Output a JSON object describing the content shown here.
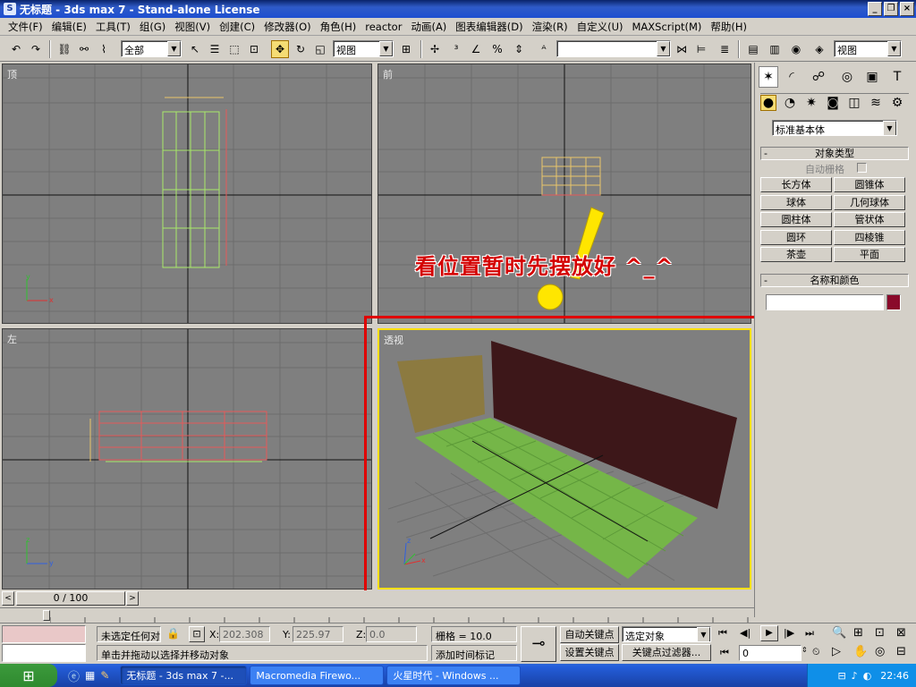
{
  "window": {
    "title": "无标题 - 3ds max 7 - Stand-alone License",
    "icon": "3dsmax-icon"
  },
  "menu": [
    "文件(F)",
    "编辑(E)",
    "工具(T)",
    "组(G)",
    "视图(V)",
    "创建(C)",
    "修改器(O)",
    "角色(H)",
    "reactor",
    "动画(A)",
    "图表编辑器(D)",
    "渲染(R)",
    "自定义(U)",
    "MAXScript(M)",
    "帮助(H)"
  ],
  "toolbar": {
    "selection_filter": "全部",
    "ref_coord": "视图",
    "named_selection": "",
    "view_dropdown": "视图"
  },
  "viewports": {
    "top": "顶",
    "front": "前",
    "left": "左",
    "perspective": "透视"
  },
  "annotation": "看位置暂时先摆放好 ^_^",
  "command_panel": {
    "category_dropdown": "标准基本体",
    "object_type_title": "对象类型",
    "autogrid_label": "自动栅格",
    "objects": [
      "长方体",
      "圆锥体",
      "球体",
      "几何球体",
      "圆柱体",
      "管状体",
      "圆环",
      "四棱锥",
      "茶壶",
      "平面"
    ],
    "name_color_title": "名称和颜色",
    "name_value": "",
    "color": "#8a0a2a"
  },
  "timeline": {
    "frame": "0 / 100",
    "ticks": [
      "0",
      "5",
      "10",
      "15",
      "20",
      "25",
      "30",
      "35",
      "40",
      "45",
      "50",
      "55",
      "60",
      "65",
      "70",
      "75",
      "80",
      "85",
      "90",
      "95",
      "100"
    ]
  },
  "status": {
    "selection": "未选定任何对",
    "prompt": "单击并拖动以选择并移动对象",
    "x_label": "X:",
    "x": "202.308",
    "y_label": "Y:",
    "y": "225.97",
    "z_label": "Z:",
    "z": "0.0",
    "grid": "栅格 = 10.0",
    "add_time_tag": "添加时间标记",
    "auto_key": "自动关键点",
    "set_key": "设置关键点",
    "key_mode": "选定对象",
    "key_filter": "关键点过滤器...",
    "frame_field": "0"
  },
  "taskbar": {
    "items": [
      "无标题 - 3ds max 7 -...",
      "Macromedia Firewo...",
      "火星时代 - Windows ..."
    ],
    "clock": "22:46"
  }
}
